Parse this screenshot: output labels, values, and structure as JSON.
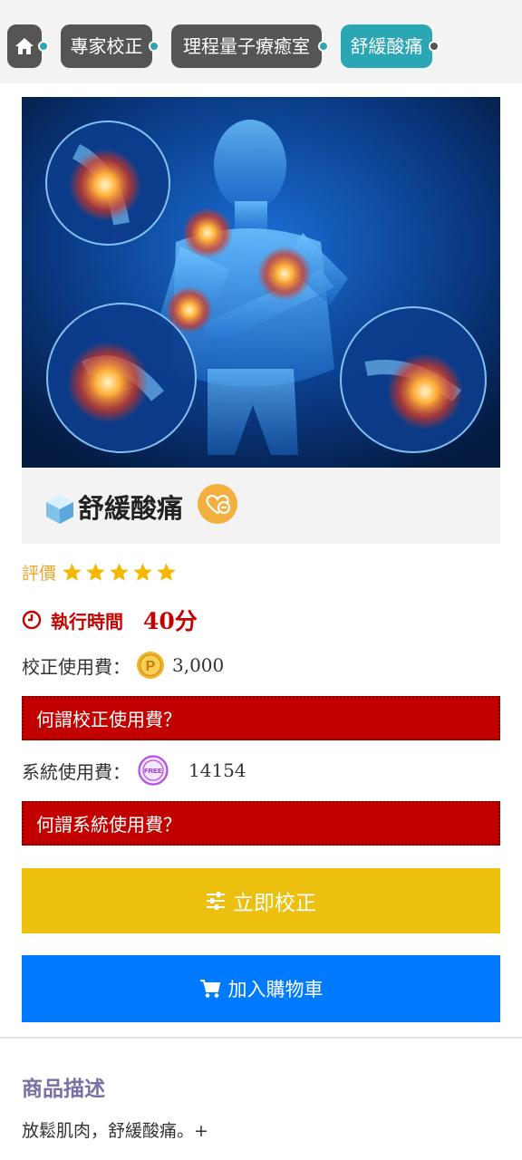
{
  "breadcrumb": {
    "home_icon": "home-icon",
    "items": [
      "專家校正",
      "理程量子療癒室",
      "舒緩酸痛"
    ]
  },
  "product": {
    "title": "舒緩酸痛",
    "rating_label": "評價",
    "stars": 5,
    "exec_label": "執行時間",
    "exec_value": "40分",
    "calibration_fee_label": "校正使用費：",
    "calibration_fee_value": "3,000",
    "calibration_fee_faq": "何謂校正使用費？",
    "system_fee_label": "系統使用費：",
    "system_fee_value": "14154",
    "system_fee_faq": "何謂系統使用費？",
    "coin_icon_text": "P",
    "free_icon_text": "FREE"
  },
  "buttons": {
    "calibrate": "立即校正",
    "cart": "加入購物車"
  },
  "description": {
    "title": "商品描述",
    "text": "放鬆肌肉，舒緩酸痛。+"
  },
  "colors": {
    "teal": "#2aa6b4",
    "red": "#c20000",
    "yellow": "#edc00f",
    "blue": "#007bff",
    "star": "#f5b800"
  }
}
